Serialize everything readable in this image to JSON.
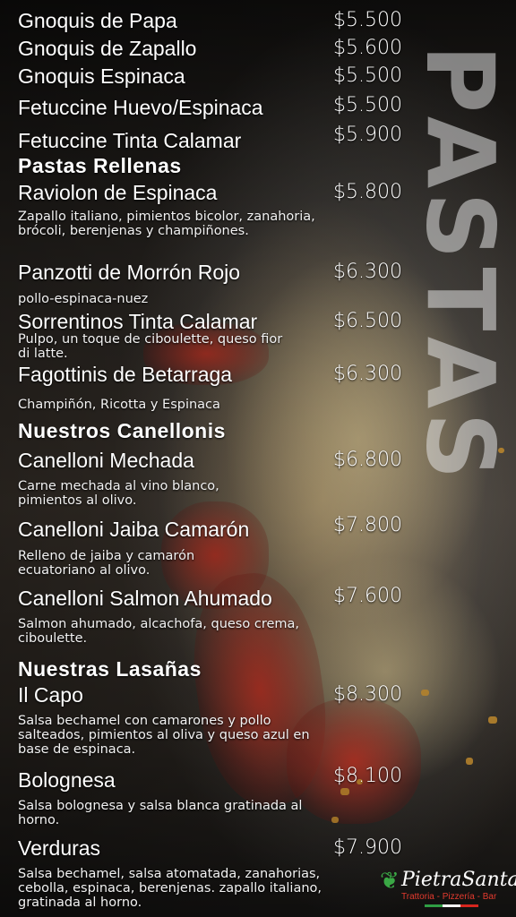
{
  "side_title": [
    "P",
    "A",
    "S",
    "T",
    "A",
    "S"
  ],
  "menu": {
    "pastas": [
      {
        "name": "Gnoquis de Papa",
        "price": "$5.500"
      },
      {
        "name": "Gnoquis de Zapallo",
        "price": "$5.600"
      },
      {
        "name": "Gnoquis Espinaca",
        "price": "$5.500"
      },
      {
        "name": "Fetuccine Huevo/Espinaca",
        "price": "$5.500"
      },
      {
        "name": "Fetuccine Tinta Calamar",
        "price": "$5.900"
      }
    ],
    "rellenas_title": "Pastas Rellenas",
    "rellenas": [
      {
        "name": "Raviolon de Espinaca",
        "price": "$5.800",
        "desc": "Zapallo italiano, pimientos bicolor, zanahoria, brócoli, berenjenas y champiñones."
      },
      {
        "name": "Panzotti de Morrón Rojo",
        "price": "$6.300",
        "desc": "pollo-espinaca-nuez"
      },
      {
        "name": "Sorrentinos Tinta Calamar",
        "price": "$6.500",
        "desc": "Pulpo, un toque de ciboulette, queso fior di latte."
      },
      {
        "name": "Fagottinis de Betarraga",
        "price": "$6.300",
        "desc": "Champiñón, Ricotta y Espinaca"
      }
    ],
    "canellonis_title": "Nuestros Canellonis",
    "canellonis": [
      {
        "name": "Canelloni Mechada",
        "price": "$6.800",
        "desc": "Carne mechada al vino blanco, pimientos al olivo."
      },
      {
        "name": "Canelloni Jaiba Camarón",
        "price": "$7.800",
        "desc": "Relleno de jaiba y camarón ecuatoriano al olivo."
      },
      {
        "name": "Canelloni Salmon Ahumado",
        "price": "$7.600",
        "desc": "Salmon ahumado, alcachofa, queso crema, ciboulette."
      }
    ],
    "lasanas_title": "Nuestras Lasañas",
    "lasanas": [
      {
        "name": "Il Capo",
        "price": "$8.300",
        "desc": "Salsa bechamel con camarones y pollo salteados, pimientos al oliva y queso azul en base de espinaca."
      },
      {
        "name": "Bolognesa",
        "price": "$8.100",
        "desc": "Salsa bolognesa y salsa blanca gratinada al horno."
      },
      {
        "name": "Verduras",
        "price": "$7.900",
        "desc": "Salsa bechamel, salsa atomatada, zanahorias, cebolla, espinaca, berenjenas. zapallo italiano, gratinada al horno."
      }
    ]
  },
  "logo": {
    "name": "PietraSanta",
    "tagline": "Trattoria - Pizzería - Bar",
    "icon": "leaf-icon"
  },
  "colors": {
    "logo_green": "#3aa845",
    "logo_red": "#e23a2e",
    "flag": [
      "#2f9e44",
      "#ffffff",
      "#d7261e"
    ]
  }
}
